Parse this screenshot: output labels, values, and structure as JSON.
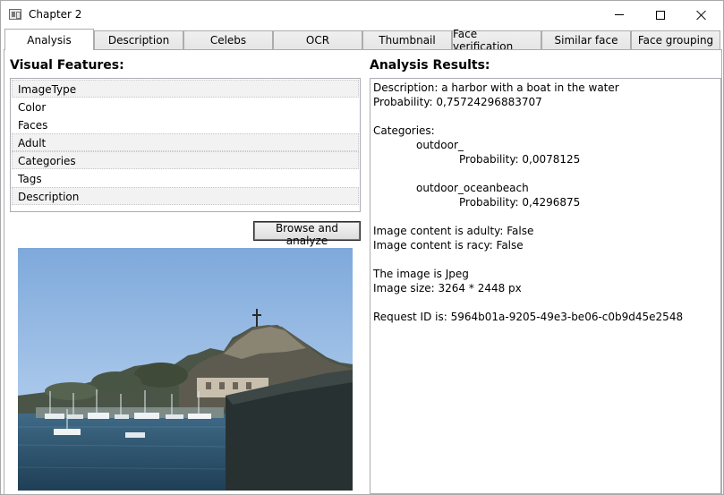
{
  "window": {
    "title": "Chapter 2"
  },
  "tabs": [
    {
      "label": "Analysis",
      "active": true
    },
    {
      "label": "Description",
      "active": false
    },
    {
      "label": "Celebs",
      "active": false
    },
    {
      "label": "OCR",
      "active": false
    },
    {
      "label": "Thumbnail",
      "active": false
    },
    {
      "label": "Face verification",
      "active": false
    },
    {
      "label": "Similar face",
      "active": false
    },
    {
      "label": "Face grouping",
      "active": false
    }
  ],
  "visual_features": {
    "heading": "Visual Features:",
    "items": [
      {
        "label": "ImageType",
        "selected": true
      },
      {
        "label": "Color",
        "selected": false
      },
      {
        "label": "Faces",
        "selected": false
      },
      {
        "label": "Adult",
        "selected": true
      },
      {
        "label": "Categories",
        "selected": true
      },
      {
        "label": "Tags",
        "selected": false
      },
      {
        "label": "Description",
        "selected": true
      }
    ]
  },
  "browse_button": "Browse and analyze",
  "photo": {
    "icon": "harbor-photo-image"
  },
  "results": {
    "heading": "Analysis Results:",
    "lines": [
      "Description: a harbor with a boat in the water",
      "Probability: 0,75724296883707",
      "",
      "Categories:",
      "outdoor_",
      "Probability: 0,0078125",
      "",
      "outdoor_oceanbeach",
      "Probability: 0,4296875",
      "",
      "Image content is adulty: False",
      "Image content is racy: False",
      "",
      "The image is Jpeg",
      "Image size: 3264 * 2448 px",
      "",
      "Request ID is: 5964b01a-9205-49e3-be06-c0b9d45e2548"
    ]
  }
}
